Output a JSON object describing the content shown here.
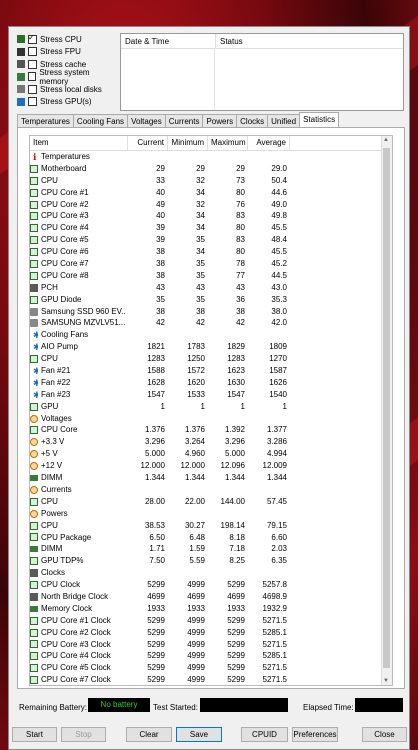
{
  "stress": [
    {
      "label": "Stress CPU",
      "checked": true,
      "icon": "cpu-icon"
    },
    {
      "label": "Stress FPU",
      "checked": false,
      "icon": "fpu-icon"
    },
    {
      "label": "Stress cache",
      "checked": false,
      "icon": "cache-icon"
    },
    {
      "label": "Stress system memory",
      "checked": false,
      "icon": "memory-icon"
    },
    {
      "label": "Stress local disks",
      "checked": false,
      "icon": "disk-icon"
    },
    {
      "label": "Stress GPU(s)",
      "checked": false,
      "icon": "gpu-icon"
    }
  ],
  "log": {
    "col_date": "Date & Time",
    "col_status": "Status"
  },
  "tabs": [
    "Temperatures",
    "Cooling Fans",
    "Voltages",
    "Currents",
    "Powers",
    "Clocks",
    "Unified",
    "Statistics"
  ],
  "active_tab": "Statistics",
  "table": {
    "headers": {
      "item": "Item",
      "current": "Current",
      "minimum": "Minimum",
      "maximum": "Maximum",
      "average": "Average"
    },
    "rows": [
      {
        "type": "group",
        "icon": "temp",
        "label": "Temperatures"
      },
      {
        "type": "item",
        "icon": "sq",
        "label": "Motherboard",
        "cur": "29",
        "min": "29",
        "max": "29",
        "avg": "29.0"
      },
      {
        "type": "item",
        "icon": "sq",
        "label": "CPU",
        "cur": "33",
        "min": "32",
        "max": "73",
        "avg": "50.4"
      },
      {
        "type": "item",
        "icon": "sq",
        "label": "CPU Core #1",
        "cur": "40",
        "min": "34",
        "max": "80",
        "avg": "44.6"
      },
      {
        "type": "item",
        "icon": "sq",
        "label": "CPU Core #2",
        "cur": "49",
        "min": "32",
        "max": "76",
        "avg": "49.0"
      },
      {
        "type": "item",
        "icon": "sq",
        "label": "CPU Core #3",
        "cur": "40",
        "min": "34",
        "max": "83",
        "avg": "49.8"
      },
      {
        "type": "item",
        "icon": "sq",
        "label": "CPU Core #4",
        "cur": "39",
        "min": "34",
        "max": "80",
        "avg": "45.5"
      },
      {
        "type": "item",
        "icon": "sq",
        "label": "CPU Core #5",
        "cur": "39",
        "min": "35",
        "max": "83",
        "avg": "48.4"
      },
      {
        "type": "item",
        "icon": "sq",
        "label": "CPU Core #6",
        "cur": "38",
        "min": "34",
        "max": "80",
        "avg": "45.5"
      },
      {
        "type": "item",
        "icon": "sq",
        "label": "CPU Core #7",
        "cur": "38",
        "min": "35",
        "max": "78",
        "avg": "45.2"
      },
      {
        "type": "item",
        "icon": "sq",
        "label": "CPU Core #8",
        "cur": "38",
        "min": "35",
        "max": "77",
        "avg": "44.5"
      },
      {
        "type": "item",
        "icon": "chip",
        "label": "PCH",
        "cur": "43",
        "min": "43",
        "max": "43",
        "avg": "43.0"
      },
      {
        "type": "item",
        "icon": "sq",
        "label": "GPU Diode",
        "cur": "35",
        "min": "35",
        "max": "36",
        "avg": "35.3"
      },
      {
        "type": "item",
        "icon": "disk",
        "label": "Samsung SSD 960 EV...",
        "cur": "38",
        "min": "38",
        "max": "38",
        "avg": "38.0"
      },
      {
        "type": "item",
        "icon": "disk",
        "label": "SAMSUNG MZVLV51...",
        "cur": "42",
        "min": "42",
        "max": "42",
        "avg": "42.0"
      },
      {
        "type": "group",
        "icon": "fan",
        "label": "Cooling Fans"
      },
      {
        "type": "item",
        "icon": "fan",
        "label": "AIO Pump",
        "cur": "1821",
        "min": "1783",
        "max": "1829",
        "avg": "1809"
      },
      {
        "type": "item",
        "icon": "sq",
        "label": "CPU",
        "cur": "1283",
        "min": "1250",
        "max": "1283",
        "avg": "1270"
      },
      {
        "type": "item",
        "icon": "fan",
        "label": "Fan #21",
        "cur": "1588",
        "min": "1572",
        "max": "1623",
        "avg": "1587"
      },
      {
        "type": "item",
        "icon": "fan",
        "label": "Fan #22",
        "cur": "1628",
        "min": "1620",
        "max": "1630",
        "avg": "1626"
      },
      {
        "type": "item",
        "icon": "fan",
        "label": "Fan #23",
        "cur": "1547",
        "min": "1533",
        "max": "1547",
        "avg": "1540"
      },
      {
        "type": "item",
        "icon": "sq",
        "label": "GPU",
        "cur": "1",
        "min": "1",
        "max": "1",
        "avg": "1"
      },
      {
        "type": "group",
        "icon": "volt",
        "label": "Voltages"
      },
      {
        "type": "item",
        "icon": "sq",
        "label": "CPU Core",
        "cur": "1.376",
        "min": "1.376",
        "max": "1.392",
        "avg": "1.377"
      },
      {
        "type": "item",
        "icon": "volt",
        "label": "+3.3 V",
        "cur": "3.296",
        "min": "3.264",
        "max": "3.296",
        "avg": "3.286"
      },
      {
        "type": "item",
        "icon": "volt",
        "label": "+5 V",
        "cur": "5.000",
        "min": "4.960",
        "max": "5.000",
        "avg": "4.994"
      },
      {
        "type": "item",
        "icon": "volt",
        "label": "+12 V",
        "cur": "12.000",
        "min": "12.000",
        "max": "12.096",
        "avg": "12.009"
      },
      {
        "type": "item",
        "icon": "mem",
        "label": "DIMM",
        "cur": "1.344",
        "min": "1.344",
        "max": "1.344",
        "avg": "1.344"
      },
      {
        "type": "group",
        "icon": "volt",
        "label": "Currents"
      },
      {
        "type": "item",
        "icon": "sq",
        "label": "CPU",
        "cur": "28.00",
        "min": "22.00",
        "max": "144.00",
        "avg": "57.45"
      },
      {
        "type": "group",
        "icon": "volt",
        "label": "Powers"
      },
      {
        "type": "item",
        "icon": "sq",
        "label": "CPU",
        "cur": "38.53",
        "min": "30.27",
        "max": "198.14",
        "avg": "79.15"
      },
      {
        "type": "item",
        "icon": "sq",
        "label": "CPU Package",
        "cur": "6.50",
        "min": "6.48",
        "max": "8.18",
        "avg": "6.60"
      },
      {
        "type": "item",
        "icon": "mem",
        "label": "DIMM",
        "cur": "1.71",
        "min": "1.59",
        "max": "7.18",
        "avg": "2.03"
      },
      {
        "type": "item",
        "icon": "sq",
        "label": "GPU TDP%",
        "cur": "7.50",
        "min": "5.59",
        "max": "8.25",
        "avg": "6.35"
      },
      {
        "type": "group",
        "icon": "chip",
        "label": "Clocks"
      },
      {
        "type": "item",
        "icon": "sq",
        "label": "CPU Clock",
        "cur": "5299",
        "min": "4999",
        "max": "5299",
        "avg": "5257.8"
      },
      {
        "type": "item",
        "icon": "chip",
        "label": "North Bridge Clock",
        "cur": "4699",
        "min": "4699",
        "max": "4699",
        "avg": "4698.9"
      },
      {
        "type": "item",
        "icon": "mem",
        "label": "Memory Clock",
        "cur": "1933",
        "min": "1933",
        "max": "1933",
        "avg": "1932.9"
      },
      {
        "type": "item",
        "icon": "sq",
        "label": "CPU Core #1 Clock",
        "cur": "5299",
        "min": "4999",
        "max": "5299",
        "avg": "5271.5"
      },
      {
        "type": "item",
        "icon": "sq",
        "label": "CPU Core #2 Clock",
        "cur": "5299",
        "min": "4999",
        "max": "5299",
        "avg": "5285.1"
      },
      {
        "type": "item",
        "icon": "sq",
        "label": "CPU Core #3 Clock",
        "cur": "5299",
        "min": "4999",
        "max": "5299",
        "avg": "5271.5"
      },
      {
        "type": "item",
        "icon": "sq",
        "label": "CPU Core #4 Clock",
        "cur": "5299",
        "min": "4999",
        "max": "5299",
        "avg": "5285.1"
      },
      {
        "type": "item",
        "icon": "sq",
        "label": "CPU Core #5 Clock",
        "cur": "5299",
        "min": "4999",
        "max": "5299",
        "avg": "5271.5"
      },
      {
        "type": "item",
        "icon": "sq",
        "label": "CPU Core #7 Clock",
        "cur": "5299",
        "min": "4999",
        "max": "5299",
        "avg": "5271.5"
      }
    ]
  },
  "status": {
    "battery_label": "Remaining Battery:",
    "battery_value": "No battery",
    "started_label": "Test Started:",
    "elapsed_label": "Elapsed Time:",
    "battery_color": "#2ecc40"
  },
  "buttons": {
    "start": "Start",
    "stop": "Stop",
    "clear": "Clear",
    "save": "Save",
    "cpuid": "CPUID",
    "preferences": "Preferences",
    "close": "Close"
  }
}
